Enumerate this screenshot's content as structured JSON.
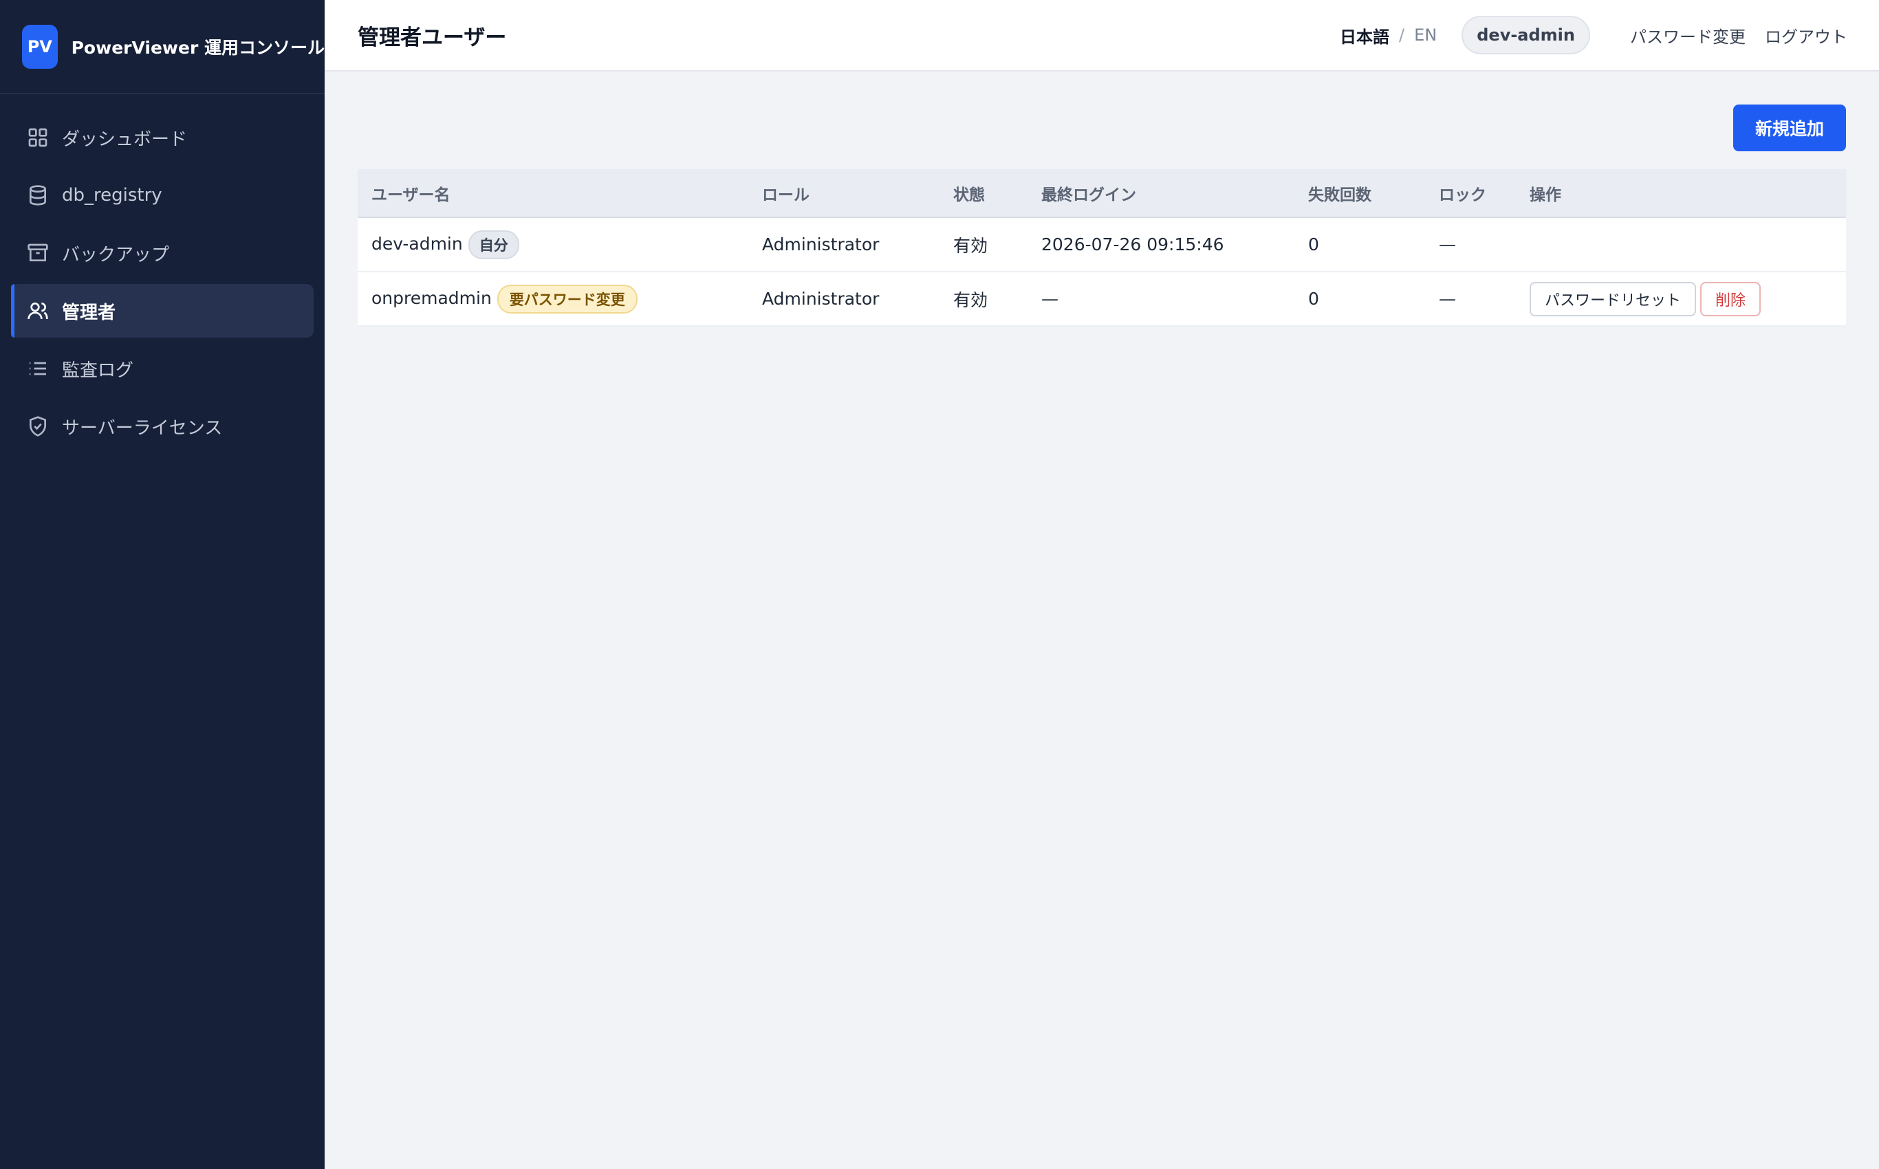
{
  "app": {
    "logo_text": "PV",
    "name": "PowerViewer 運用コンソール"
  },
  "sidebar": {
    "items": [
      {
        "label": "ダッシュボード",
        "icon": "grid-icon",
        "active": false
      },
      {
        "label": "db_registry",
        "icon": "database-icon",
        "active": false
      },
      {
        "label": "バックアップ",
        "icon": "archive-icon",
        "active": false
      },
      {
        "label": "管理者",
        "icon": "users-icon",
        "active": true
      },
      {
        "label": "監査ログ",
        "icon": "list-icon",
        "active": false
      },
      {
        "label": "サーバーライセンス",
        "icon": "shield-check-icon",
        "active": false
      }
    ]
  },
  "header": {
    "title": "管理者ユーザー",
    "lang_ja": "日本語",
    "lang_sep": "/",
    "lang_en": "EN",
    "user": "dev-admin",
    "change_password": "パスワード変更",
    "logout": "ログアウト"
  },
  "toolbar": {
    "add_label": "新規追加"
  },
  "table": {
    "headers": [
      "ユーザー名",
      "ロール",
      "状態",
      "最終ログイン",
      "失敗回数",
      "ロック",
      "操作"
    ],
    "rows": [
      {
        "username": "dev-admin",
        "badge": "自分",
        "badge_type": "self",
        "role": "Administrator",
        "status": "有効",
        "last_login": "2026-07-26 09:15:46",
        "failures": "0",
        "lock": "—",
        "actions": []
      },
      {
        "username": "onpremadmin",
        "badge": "要パスワード変更",
        "badge_type": "warn",
        "role": "Administrator",
        "status": "有効",
        "last_login": "—",
        "failures": "0",
        "lock": "—",
        "actions": [
          "パスワードリセット",
          "削除"
        ]
      }
    ]
  },
  "colors": {
    "sidebar_bg": "#162038",
    "accent": "#1f5cf2",
    "danger": "#d13b3b",
    "warn_bg": "#fdf1cc"
  }
}
